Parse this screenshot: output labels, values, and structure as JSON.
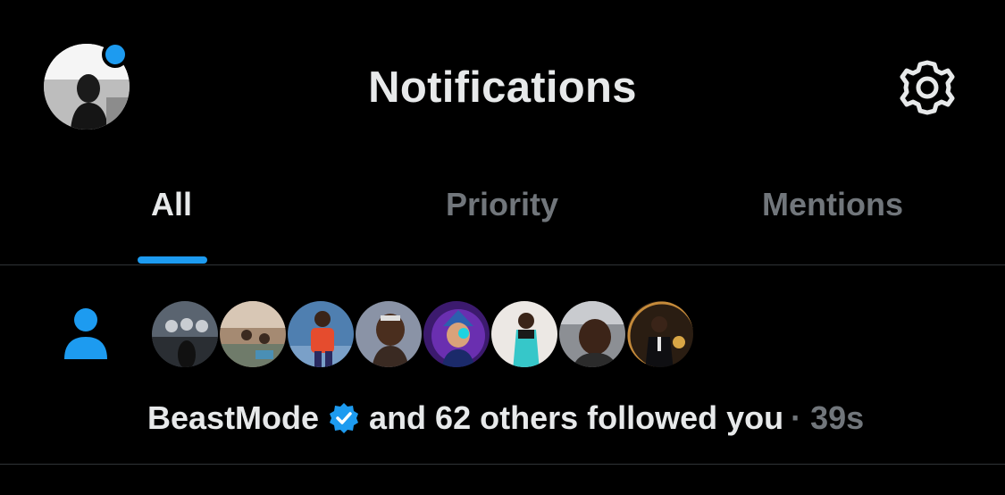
{
  "header": {
    "title": "Notifications",
    "has_unread_dot": true,
    "profile_icon": "user-avatar",
    "settings_icon": "gear-icon"
  },
  "tabs": [
    {
      "label": "All",
      "active": true
    },
    {
      "label": "Priority",
      "active": false
    },
    {
      "label": "Mentions",
      "active": false
    }
  ],
  "notification": {
    "icon": "person-icon",
    "user": "BeastMode",
    "verified": true,
    "rest": "and 62 others followed you",
    "separator": "·",
    "time": "39s",
    "avatar_count": 8
  },
  "colors": {
    "accent": "#1d9bf0",
    "text_primary": "#e7e9ea",
    "text_secondary": "#71767b",
    "background": "#000000",
    "divider": "#2f3336"
  }
}
